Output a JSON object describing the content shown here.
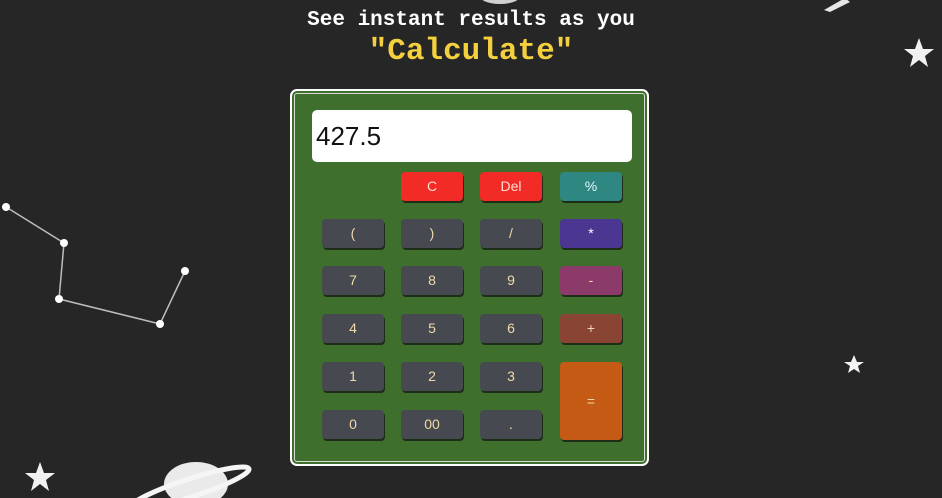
{
  "header": {
    "subtitle": "See instant results as you",
    "headline": "\"Calculate\""
  },
  "calculator": {
    "display_value": "427.5",
    "keys": {
      "clear": "C",
      "delete": "Del",
      "percent": "%",
      "open_paren": "(",
      "close_paren": ")",
      "divide": "/",
      "multiply": "*",
      "seven": "7",
      "eight": "8",
      "nine": "9",
      "minus": "-",
      "four": "4",
      "five": "5",
      "six": "6",
      "plus": "+",
      "one": "1",
      "two": "2",
      "three": "3",
      "equals": "=",
      "zero": "0",
      "double_zero": "00",
      "decimal": "."
    }
  },
  "colors": {
    "background": "#262626",
    "panel": "#3e6f2c",
    "headline": "#f4d03f",
    "key_default": "#464a50",
    "key_clear": "#f22b26",
    "key_percent": "#2e8780",
    "key_multiply": "#4b3691",
    "key_minus": "#8c3a6a",
    "key_plus": "#8a4433",
    "key_equals": "#c45a14"
  }
}
